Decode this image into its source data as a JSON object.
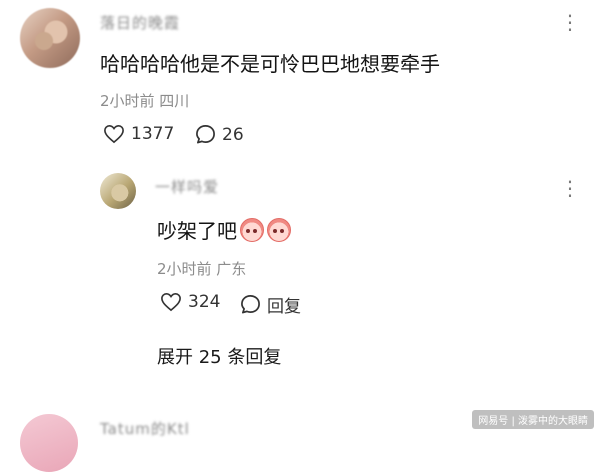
{
  "comment1": {
    "username": "落日的晚霞",
    "more": "⋮",
    "text": "哈哈哈哈他是不是可怜巴巴地想要牵手",
    "meta": "2小时前 四川",
    "likes": "1377",
    "replies": "26"
  },
  "reply1": {
    "username": "一样吗爱",
    "more": "⋮",
    "text": "吵架了吧",
    "meta": "2小时前 广东",
    "likes": "324",
    "reply_label": "回复"
  },
  "expand_label": "展开 25 条回复",
  "comment2": {
    "username": "Tatum的Ktl"
  },
  "watermark": "网易号 | 泼雾中的大眼睛",
  "icons": {
    "like": "heart-outline-icon",
    "comment": "speech-bubble-icon",
    "more": "more-vertical-icon",
    "emoji": "sad-face-emoji-icon"
  }
}
